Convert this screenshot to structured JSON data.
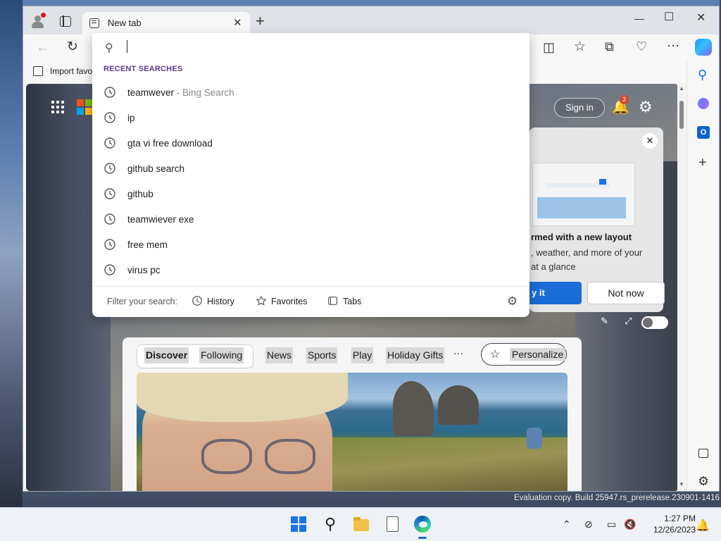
{
  "browser": {
    "tab": {
      "title": "New tab",
      "close": "✕"
    },
    "new_tab": "+",
    "window_controls": {
      "minimize": "—",
      "maximize": "☐",
      "close": "✕"
    },
    "toolbar": {
      "back": "←",
      "refresh": "↻",
      "split": "◫",
      "favorites": "☆",
      "collections": "⧉",
      "health": "♡",
      "more": "⋯"
    },
    "favorites_bar": {
      "import_label": "Import favo"
    }
  },
  "address_dropdown": {
    "query": "",
    "header": "RECENT SEARCHES",
    "items": [
      {
        "text": "teamwever",
        "suffix": " - Bing Search"
      },
      {
        "text": "ip",
        "suffix": ""
      },
      {
        "text": "gta vi free download",
        "suffix": ""
      },
      {
        "text": "github search",
        "suffix": ""
      },
      {
        "text": "github",
        "suffix": ""
      },
      {
        "text": "teamwiever exe",
        "suffix": ""
      },
      {
        "text": "free mem",
        "suffix": ""
      },
      {
        "text": "virus pc",
        "suffix": ""
      }
    ],
    "filter": {
      "label": "Filter your search:",
      "history": "History",
      "favorites": "Favorites",
      "tabs": "Tabs"
    }
  },
  "newtab": {
    "signin": "Sign in",
    "notification_count": "3",
    "promo": {
      "close": "✕",
      "line1": "rmed with a new layout",
      "line2": ", weather, and more of your",
      "line3": "at a glance",
      "primary": "y it",
      "secondary": "Not now"
    },
    "feed_tabs": {
      "discover": "Discover",
      "following": "Following",
      "news": "News",
      "sports": "Sports",
      "play": "Play",
      "holiday": "Holiday Gifts",
      "more": "···",
      "personalize": "Personalize"
    }
  },
  "system": {
    "watermark": "Evaluation copy. Build 25947.rs_prerelease.230901-1416",
    "time": "1:27 PM",
    "date": "12/26/2023"
  },
  "colors": {
    "accent": "#1a6cd6",
    "header_purple": "#5a3a8a",
    "badge": "#d24726"
  }
}
